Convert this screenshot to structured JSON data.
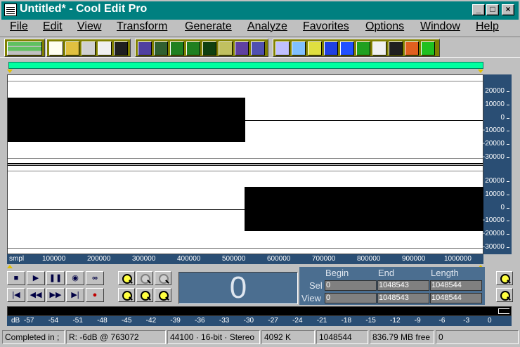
{
  "window": {
    "title": "Untitled* - Cool Edit Pro",
    "min": "_",
    "max": "□",
    "close": "×"
  },
  "menu": [
    "File",
    "Edit",
    "View",
    "Transform",
    "Generate",
    "Analyze",
    "Favorites",
    "Options",
    "Window",
    "Help"
  ],
  "toolbar": {
    "group1_icons": [
      "multitrack-view-icon"
    ],
    "group2_icons": [
      "new-file-icon",
      "open-file-icon",
      "close-file-icon",
      "save-as-icon",
      "save-icon"
    ],
    "group3_icons": [
      "marker-icon",
      "noise-icon",
      "mix-icon",
      "mix-paste-icon",
      "waveform-icon",
      "edit-icon",
      "cue-icon",
      "play-cue-icon"
    ],
    "group4_icons": [
      "ap-icon",
      "ear-icon",
      "dynamics-icon",
      "graphic-eq-icon",
      "delay-icon",
      "stretch-icon",
      "doppler-icon",
      "noise-reduction-icon",
      "filter-icon",
      "cd-icon"
    ]
  },
  "vertical_scale": [
    "20000",
    "10000",
    "0",
    "-10000",
    "-20000",
    "-30000"
  ],
  "horizontal_scale": {
    "unit": "smpl",
    "ticks": [
      "100000",
      "200000",
      "300000",
      "400000",
      "500000",
      "600000",
      "700000",
      "800000",
      "900000",
      "1000000"
    ]
  },
  "transport": {
    "buttons": [
      "stop",
      "play",
      "pause",
      "play-to-end",
      "loop",
      "go-to-start",
      "rewind",
      "fast-forward",
      "go-to-end",
      "record"
    ],
    "glyphs": [
      "■",
      "▶",
      "❚❚",
      "◉",
      "∞",
      "|◀",
      "◀◀",
      "▶▶",
      "▶|",
      "●"
    ]
  },
  "time_display": "0",
  "selection": {
    "headers": {
      "begin": "Begin",
      "end": "End",
      "length": "Length"
    },
    "sel": {
      "label": "Sel",
      "begin": "0",
      "end": "1048543",
      "length": "1048544"
    },
    "view": {
      "label": "View",
      "begin": "0",
      "end": "1048543",
      "length": "1048544"
    }
  },
  "level_meter": {
    "unit": "dB",
    "ticks": [
      "-57",
      "-54",
      "-51",
      "-48",
      "-45",
      "-42",
      "-39",
      "-36",
      "-33",
      "-30",
      "-27",
      "-24",
      "-21",
      "-18",
      "-15",
      "-12",
      "-9",
      "-6",
      "-3",
      "0"
    ]
  },
  "status": {
    "message": "Completed in ;",
    "recording": "R: -6dB @ 763072",
    "format": "44100 · 16-bit · Stereo",
    "size": "4092 K",
    "samples": "1048544",
    "free": "836.79 MB free",
    "extra": "0"
  }
}
